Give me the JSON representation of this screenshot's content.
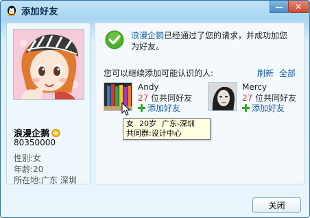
{
  "window": {
    "title": "添加好友",
    "minimize_label": "—",
    "close_label": "✕"
  },
  "profile": {
    "nickname": "浪漫企鹅",
    "qq_number": "80350000",
    "gender": "性别:女",
    "age": "年龄:20",
    "location": "所在地:广东  深圳"
  },
  "message": {
    "link_name": "浪漫企鹅",
    "text": "已经通过了您的请求，并成功加您为好友。"
  },
  "suggestions": {
    "label": "您可以继续添加可能认识的人:",
    "refresh": "刷新",
    "all": "全部",
    "friends": [
      {
        "name": "Andy",
        "common_count": "27",
        "common_suffix": " 位共同好友",
        "add_label": "添加好友"
      },
      {
        "name": "Mercy",
        "common_count": "27",
        "common_suffix": " 位共同好友",
        "add_label": "添加好友"
      }
    ]
  },
  "tooltip": {
    "gender": "女",
    "age": "20岁",
    "location": "广东-深圳",
    "group": "共同群:设计中心"
  },
  "footer": {
    "close_label": "关闭"
  },
  "colors": {
    "accent": "#1a5fa8",
    "count": "#d0342c",
    "check": "#4caf2a"
  }
}
